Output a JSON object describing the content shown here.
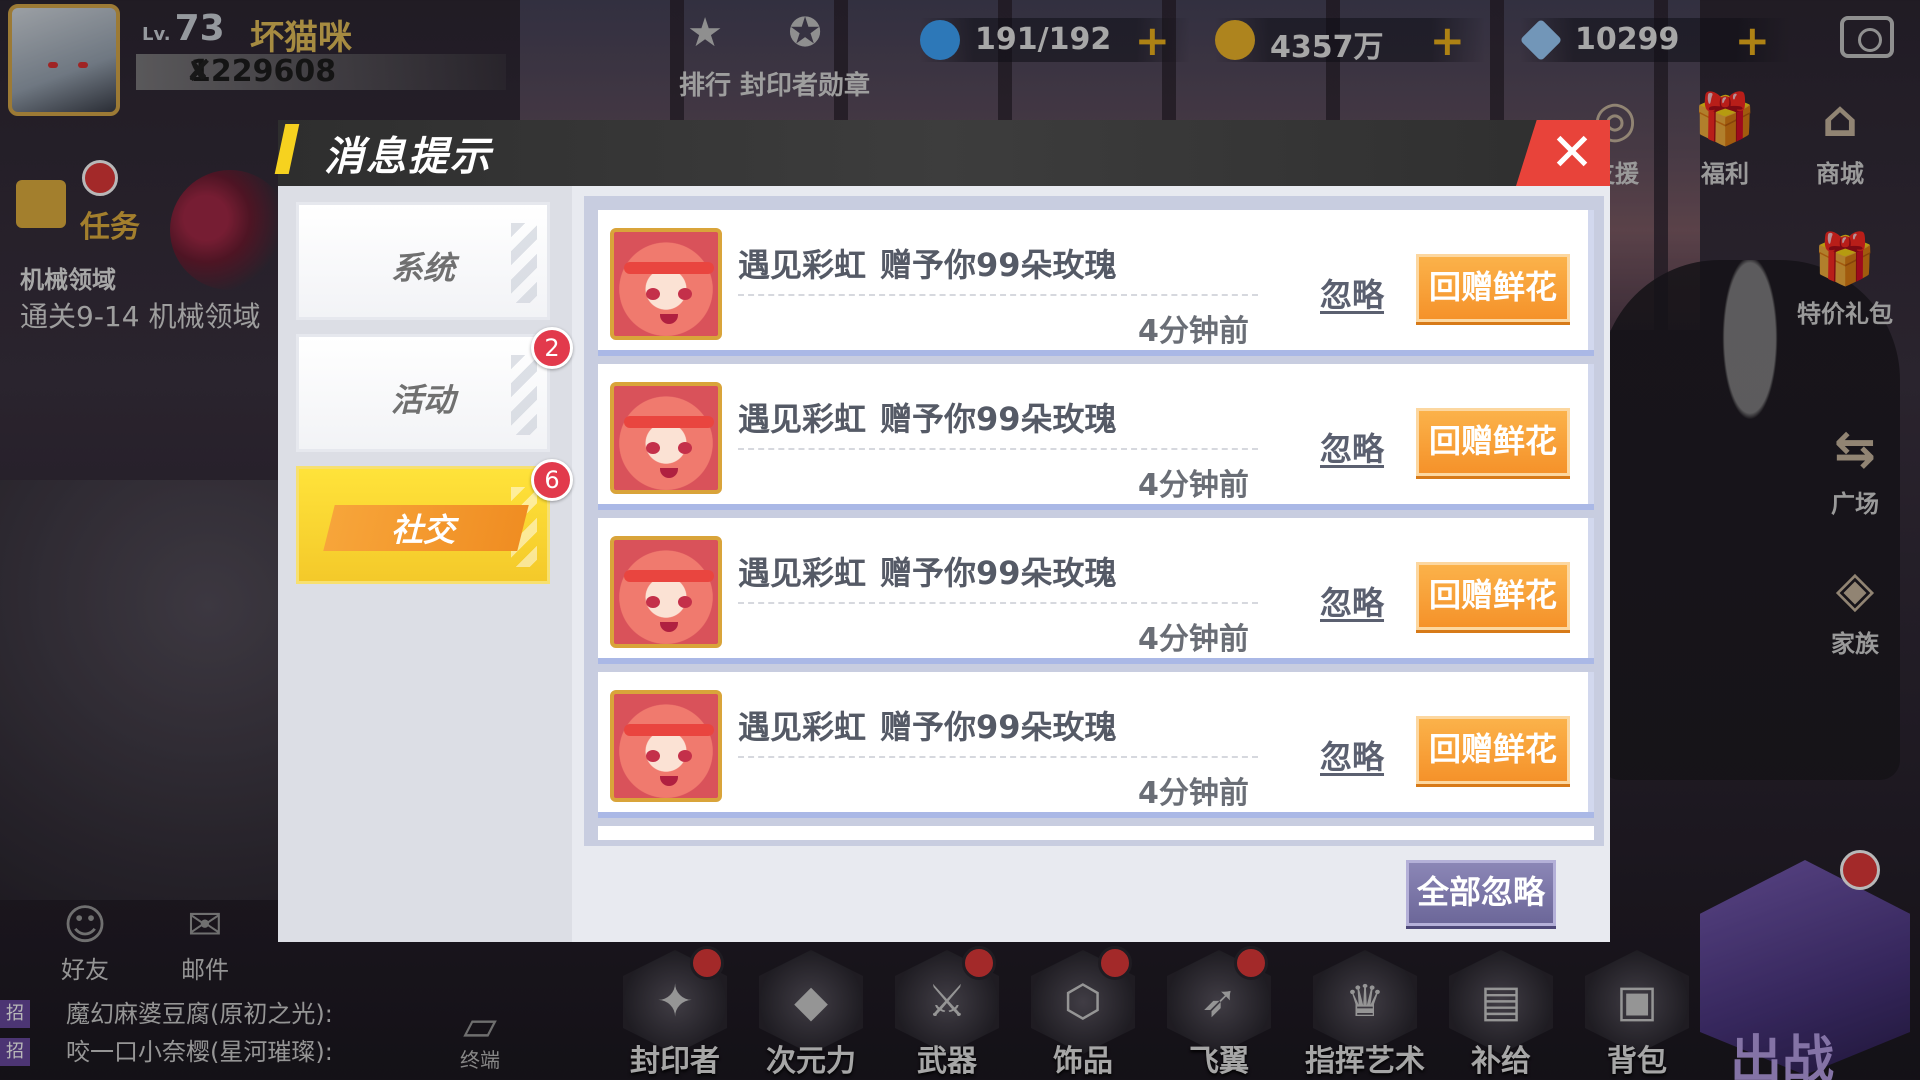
{
  "player": {
    "level_prefix": "Lv.",
    "level": "73",
    "name": "坏猫咪",
    "power": "1229608"
  },
  "top_icons": [
    {
      "label": "排行",
      "icon": "trophy-icon"
    },
    {
      "label": "封印者勋章",
      "icon": "medal-icon"
    }
  ],
  "currencies": {
    "stamina": {
      "value": "191/192",
      "icon": "stamina-potion-icon",
      "color": "#3fa7ff"
    },
    "gold": {
      "value": "4357万",
      "icon": "gold-coin-icon",
      "color": "#f1b82a"
    },
    "diamond": {
      "value": "10299",
      "icon": "diamond-icon",
      "color": "#9fd0ff"
    }
  },
  "right_menu": {
    "support": "支援",
    "welfare": "福利",
    "shop": "商城",
    "special_pack": "特价礼包",
    "plaza": "广场",
    "family": "家族"
  },
  "task": {
    "label": "任务",
    "line1": "机械领域",
    "line2": "通关9-14 机械领域"
  },
  "bottom_left": {
    "friends": "好友",
    "mail": "邮件",
    "terminal": "终端"
  },
  "chat": [
    {
      "tag": "招",
      "text": "魔幻麻婆豆腐(原初之光):"
    },
    {
      "tag": "招",
      "text": "咬一口小奈樱(星河璀璨):"
    }
  ],
  "bottom_bar": [
    {
      "label": "封印者",
      "icon": "sealer-icon",
      "dot": true
    },
    {
      "label": "次元力",
      "icon": "dimension-icon",
      "dot": false
    },
    {
      "label": "武器",
      "icon": "weapon-icon",
      "dot": true
    },
    {
      "label": "饰品",
      "icon": "accessory-icon",
      "dot": true
    },
    {
      "label": "飞翼",
      "icon": "wing-icon",
      "dot": true
    },
    {
      "label": "指挥艺术",
      "icon": "command-icon",
      "dot": false
    },
    {
      "label": "补给",
      "icon": "supply-icon",
      "dot": false
    },
    {
      "label": "背包",
      "icon": "backpack-icon",
      "dot": false
    }
  ],
  "battle": {
    "label": "出战"
  },
  "dialog": {
    "title": "消息提示",
    "close_icon": "close-icon",
    "tabs": [
      {
        "label": "系统",
        "badge": null,
        "active": false
      },
      {
        "label": "活动",
        "badge": "2",
        "active": false
      },
      {
        "label": "社交",
        "badge": "6",
        "active": true
      }
    ],
    "messages": [
      {
        "sender": "遇见彩虹",
        "text": "赠予你99朵玫瑰",
        "time": "4分钟前",
        "ignore": "忽略",
        "action": "回赠鲜花"
      },
      {
        "sender": "遇见彩虹",
        "text": "赠予你99朵玫瑰",
        "time": "4分钟前",
        "ignore": "忽略",
        "action": "回赠鲜花"
      },
      {
        "sender": "遇见彩虹",
        "text": "赠予你99朵玫瑰",
        "time": "4分钟前",
        "ignore": "忽略",
        "action": "回赠鲜花"
      },
      {
        "sender": "遇见彩虹",
        "text": "赠予你99朵玫瑰",
        "time": "4分钟前",
        "ignore": "忽略",
        "action": "回赠鲜花"
      }
    ],
    "ignore_all": "全部忽略"
  },
  "colors": {
    "accent_yellow": "#f6d21f",
    "close_red": "#e8433a",
    "action_orange": "#f5922a",
    "ignore_all_purple": "#6c6799",
    "badge_red": "#e23a4c"
  }
}
